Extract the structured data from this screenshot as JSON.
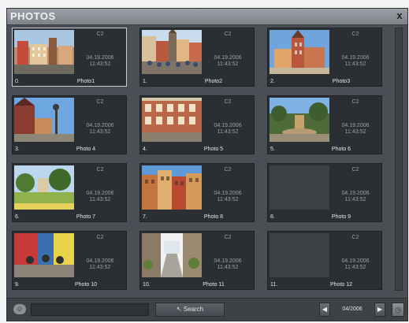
{
  "window": {
    "title": "PHOTOS",
    "close_label": "x"
  },
  "photos": [
    {
      "index": "0.",
      "name": "Photo1",
      "slot": "C2",
      "date": "04.19.2006",
      "time": "11:43:52",
      "has_image": true
    },
    {
      "index": "1.",
      "name": "Photo2",
      "slot": "C2",
      "date": "04.19.2006",
      "time": "11:43:52",
      "has_image": true
    },
    {
      "index": "2.",
      "name": "Photo3",
      "slot": "C2",
      "date": "04.19.2006",
      "time": "11:43:52",
      "has_image": true
    },
    {
      "index": "3.",
      "name": "Photo 4",
      "slot": "C2",
      "date": "04.19.2006",
      "time": "11:43:52",
      "has_image": true
    },
    {
      "index": "4.",
      "name": "Photo 5",
      "slot": "C2",
      "date": "04.19.2006",
      "time": "11:43:52",
      "has_image": true
    },
    {
      "index": "5.",
      "name": "Photo 6",
      "slot": "C2",
      "date": "04.19.2006",
      "time": "11:43:52",
      "has_image": true
    },
    {
      "index": "6.",
      "name": "Photo 7",
      "slot": "C2",
      "date": "04.19.2006",
      "time": "11:43:52",
      "has_image": true
    },
    {
      "index": "7.",
      "name": "Photo 8",
      "slot": "C2",
      "date": "04.19.2006",
      "time": "11:43:52",
      "has_image": true
    },
    {
      "index": "8.",
      "name": "Photo 9",
      "slot": "C2",
      "date": "04.19.2006",
      "time": "11:43:52",
      "has_image": false
    },
    {
      "index": "9.",
      "name": "Photo 10",
      "slot": "C2",
      "date": "04.19.2006",
      "time": "11:43:52",
      "has_image": true
    },
    {
      "index": "10.",
      "name": "Photo 11",
      "slot": "C2",
      "date": "04.19.2006",
      "time": "11:43:52",
      "has_image": true
    },
    {
      "index": "11.",
      "name": "Photo 12",
      "slot": "C2",
      "date": "04.19.2006",
      "time": "11:43:52",
      "has_image": false
    }
  ],
  "bottombar": {
    "search_value": "",
    "search_label": "Search",
    "prev_icon": "arrow-left-icon",
    "next_icon": "arrow-right-icon",
    "date": "04/2006",
    "settings_icon": "clock-icon"
  },
  "colors": {
    "window_bg": "#4a4f55",
    "tile_bg": "#2b2f33",
    "selected_border": "#c9cdd1"
  }
}
